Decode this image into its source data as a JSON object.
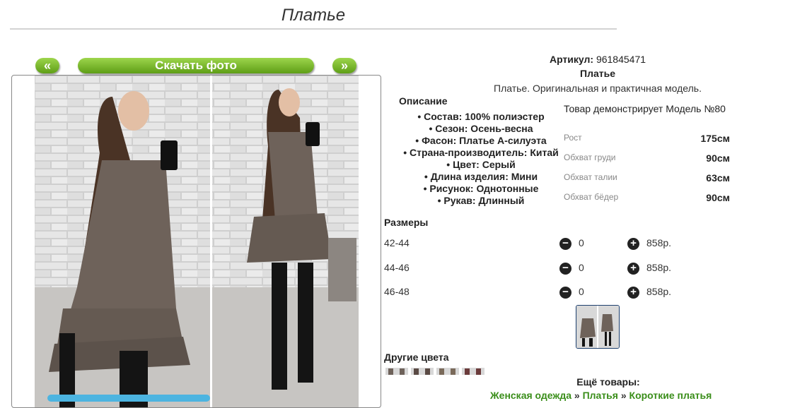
{
  "page": {
    "title": "Платье"
  },
  "gallery": {
    "prev_label": "«",
    "next_label": "»",
    "download_label": "Скачать фото"
  },
  "product": {
    "article_label": "Артикул:",
    "article_value": "961845471",
    "name": "Платье",
    "tagline": "Платье. Оригинальная и практичная модель."
  },
  "description": {
    "heading": "Описание",
    "items": [
      "Состав: 100% полиэстер",
      "Сезон: Осень-весна",
      "Фасон: Платье А-силуэта",
      "Страна-производитель: Китай",
      "Цвет: Серый",
      "Длина изделия: Мини",
      "Рисунок: Однотонные",
      "Рукав: Длинный"
    ]
  },
  "model": {
    "heading": "Товар демонстрирует Модель №80",
    "measurements": [
      {
        "label": "Рост",
        "value": "175см"
      },
      {
        "label": "Обхват груди",
        "value": "90см"
      },
      {
        "label": "Обхват талии",
        "value": "63см"
      },
      {
        "label": "Обхват бёдер",
        "value": "90см"
      }
    ]
  },
  "sizes": {
    "heading": "Размеры",
    "rows": [
      {
        "size": "42-44",
        "qty": "0",
        "price": "858р."
      },
      {
        "size": "44-46",
        "qty": "0",
        "price": "858р."
      },
      {
        "size": "46-48",
        "qty": "0",
        "price": "858р."
      }
    ]
  },
  "other_colors": {
    "heading": "Другие цвета"
  },
  "more": {
    "heading": "Ещё товары:",
    "links": [
      "Женская одежда",
      "Платья",
      "Короткие платья"
    ],
    "separator": "»"
  },
  "colors": {
    "button_green": "#6fb11f",
    "scroll_blue": "#4cb4e0",
    "dress": "#6e625a",
    "brick": "#d9d9d9",
    "link_green": "#3a8e1a"
  }
}
